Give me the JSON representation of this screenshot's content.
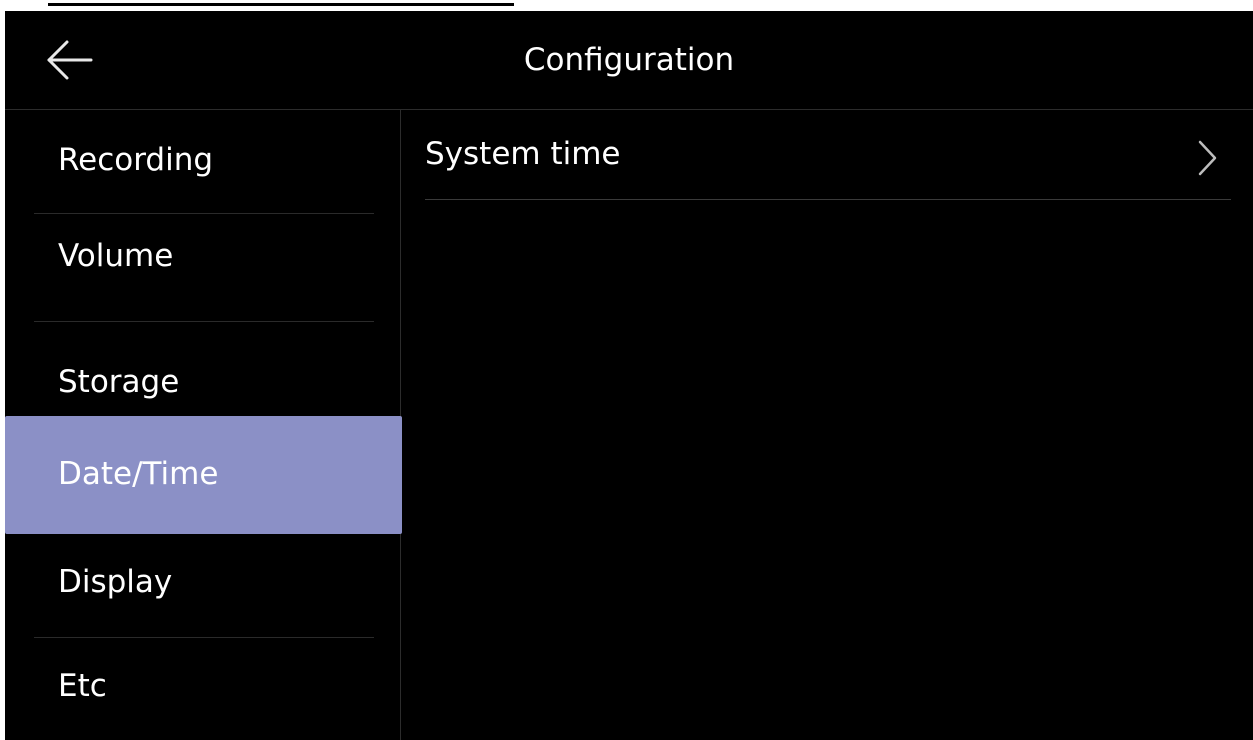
{
  "header": {
    "title": "Configuration",
    "back_icon": "arrow-left-icon"
  },
  "sidebar": {
    "items": [
      {
        "label": "Recording",
        "active": false
      },
      {
        "label": "Volume",
        "active": false
      },
      {
        "label": "Storage",
        "active": false
      },
      {
        "label": "Date/Time",
        "active": true
      },
      {
        "label": "Display",
        "active": false
      },
      {
        "label": "Etc",
        "active": false
      }
    ]
  },
  "content": {
    "rows": [
      {
        "label": "System time",
        "icon": "chevron-right-icon"
      }
    ]
  },
  "colors": {
    "background": "#000000",
    "active_item": "#8b90c6",
    "text": "#ffffff"
  }
}
